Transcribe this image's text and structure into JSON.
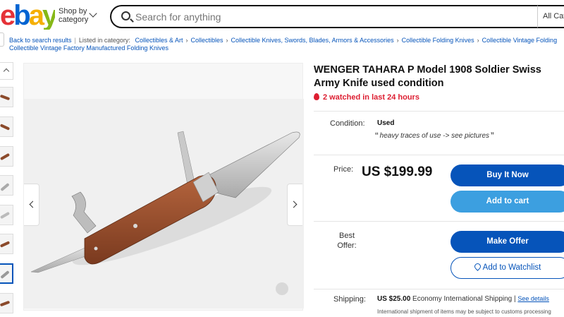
{
  "header": {
    "logo_text": "ebay",
    "logo_colors": [
      "#e53238",
      "#0064d2",
      "#f5af02",
      "#86b817"
    ],
    "shop_by_category": "Shop by category",
    "search_placeholder": "Search for anything",
    "category_select": "All Cat"
  },
  "breadcrumb": {
    "back": "Back to search results",
    "listed_in": "Listed in category:",
    "items": [
      "Collectibles & Art",
      "Collectibles",
      "Collectible Knives, Swords, Blades, Armors & Accessories",
      "Collectible Folding Knives",
      "Collectible Vintage Folding",
      "Collectible Vintage Factory Manufactured Folding Knives"
    ]
  },
  "gallery": {
    "thumbnail_count": 9,
    "selected_index": 8
  },
  "listing": {
    "title": "WENGER TAHARA P Model 1908 Soldier Swiss Army Knife used condition",
    "watch_text": "2 watched in last 24 hours",
    "condition_label": "Condition:",
    "condition_value": "Used",
    "condition_note": "heavy traces of use -> see pictures",
    "price_label": "Price:",
    "price_value": "US $199.99",
    "buy_now": "Buy It Now",
    "add_to_cart": "Add to cart",
    "best_offer_label": "Best Offer:",
    "make_offer": "Make Offer",
    "add_to_watchlist": "Add to Watchlist",
    "shipping_label": "Shipping:",
    "shipping_cost": "US $25.00",
    "shipping_method": "Economy International Shipping",
    "shipping_details_link": "See details",
    "shipping_note": "International shipment of items may be subject to customs processing"
  },
  "colors": {
    "primary": "#0654ba",
    "secondary": "#3c9fe0",
    "alert": "#dd1e31"
  }
}
